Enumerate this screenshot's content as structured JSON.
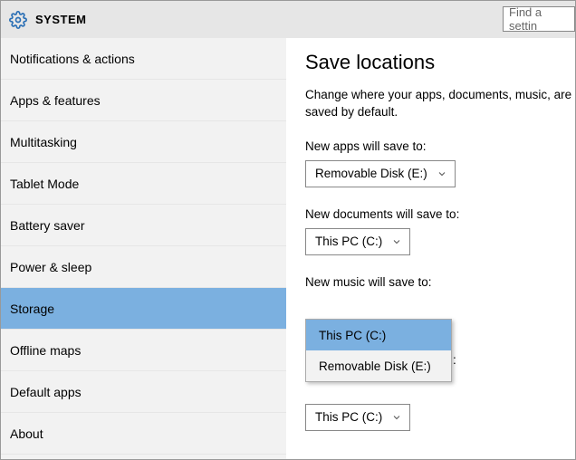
{
  "header": {
    "title": "SYSTEM",
    "search_placeholder": "Find a settin"
  },
  "sidebar": {
    "items": [
      {
        "label": "Notifications & actions"
      },
      {
        "label": "Apps & features"
      },
      {
        "label": "Multitasking"
      },
      {
        "label": "Tablet Mode"
      },
      {
        "label": "Battery saver"
      },
      {
        "label": "Power & sleep"
      },
      {
        "label": "Storage"
      },
      {
        "label": "Offline maps"
      },
      {
        "label": "Default apps"
      },
      {
        "label": "About"
      }
    ],
    "selected_index": 6
  },
  "main": {
    "title": "Save locations",
    "description": "Change where your apps, documents, music, are saved by default.",
    "fields": [
      {
        "label": "New apps will save to:",
        "value": "Removable Disk (E:)"
      },
      {
        "label": "New documents will save to:",
        "value": "This PC (C:)"
      },
      {
        "label": "New music will save to:",
        "value": "This PC (C:)"
      }
    ],
    "open_dropdown": {
      "items": [
        {
          "label": "This PC (C:)",
          "selected": true
        },
        {
          "label": "Removable Disk (E:)",
          "selected": false
        }
      ]
    },
    "extra_combo": "This PC (C:)"
  },
  "colors": {
    "accent": "#7bb0e0",
    "sidebar_bg": "#f2f2f2",
    "header_bg": "#e6e6e6"
  }
}
